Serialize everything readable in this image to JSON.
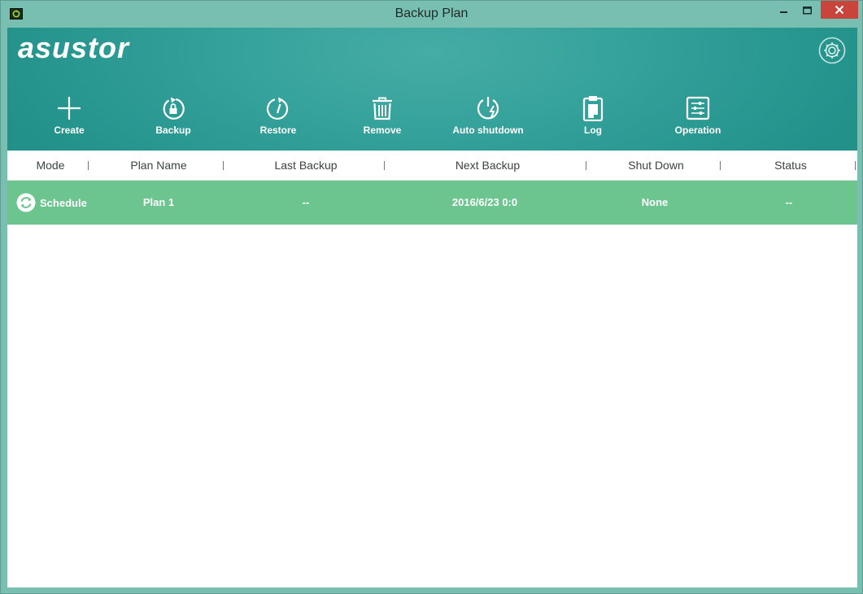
{
  "window": {
    "title": "Backup Plan"
  },
  "brand": {
    "logo_text": "asustor",
    "accent": "#2a9d95",
    "row_highlight": "#6cc48e"
  },
  "toolbar": {
    "items": [
      {
        "label": "Create",
        "icon": "plus-icon"
      },
      {
        "label": "Backup",
        "icon": "backup-lock-icon"
      },
      {
        "label": "Restore",
        "icon": "restore-icon"
      },
      {
        "label": "Remove",
        "icon": "trash-icon"
      },
      {
        "label": "Auto shutdown",
        "icon": "power-icon"
      },
      {
        "label": "Log",
        "icon": "clipboard-icon"
      },
      {
        "label": "Operation",
        "icon": "sliders-icon"
      }
    ]
  },
  "table": {
    "columns": [
      "Mode",
      "Plan Name",
      "Last Backup",
      "Next Backup",
      "Shut Down",
      "Status"
    ],
    "rows": [
      {
        "mode": "Schedule",
        "plan_name": "Plan 1",
        "last_backup": "--",
        "next_backup": "2016/6/23 0:0",
        "shut_down": "None",
        "status": "--"
      }
    ]
  }
}
